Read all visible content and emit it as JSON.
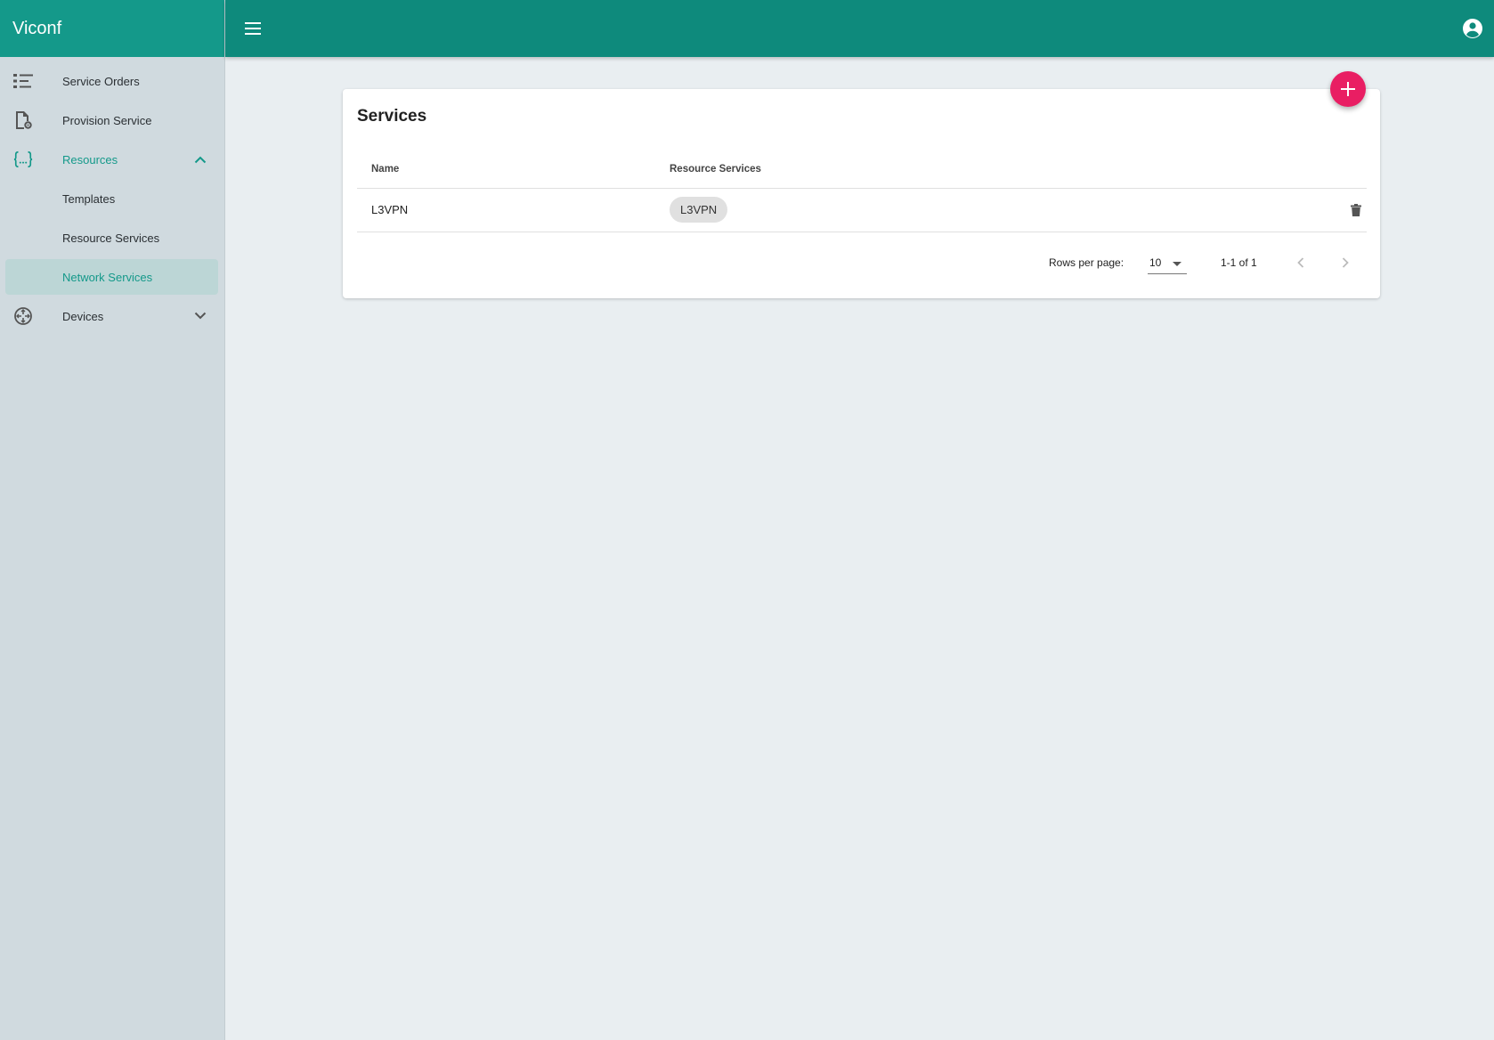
{
  "app": {
    "brand": "Viconf"
  },
  "sidebar": {
    "items": [
      {
        "label": "Service Orders"
      },
      {
        "label": "Provision Service"
      },
      {
        "label": "Resources"
      },
      {
        "label": "Templates"
      },
      {
        "label": "Resource Services"
      },
      {
        "label": "Network Services"
      },
      {
        "label": "Devices"
      }
    ]
  },
  "colors": {
    "primary": "#0e8a7c",
    "brand": "#14998a",
    "accent": "#e91e63"
  },
  "card": {
    "title": "Services",
    "columns": [
      "Name",
      "Resource Services"
    ],
    "rows": [
      {
        "name": "L3VPN",
        "resource_services": [
          "L3VPN"
        ]
      }
    ]
  },
  "pagination": {
    "rows_per_page_label": "Rows per page:",
    "rows_per_page": "10",
    "range": "1-1 of 1"
  }
}
